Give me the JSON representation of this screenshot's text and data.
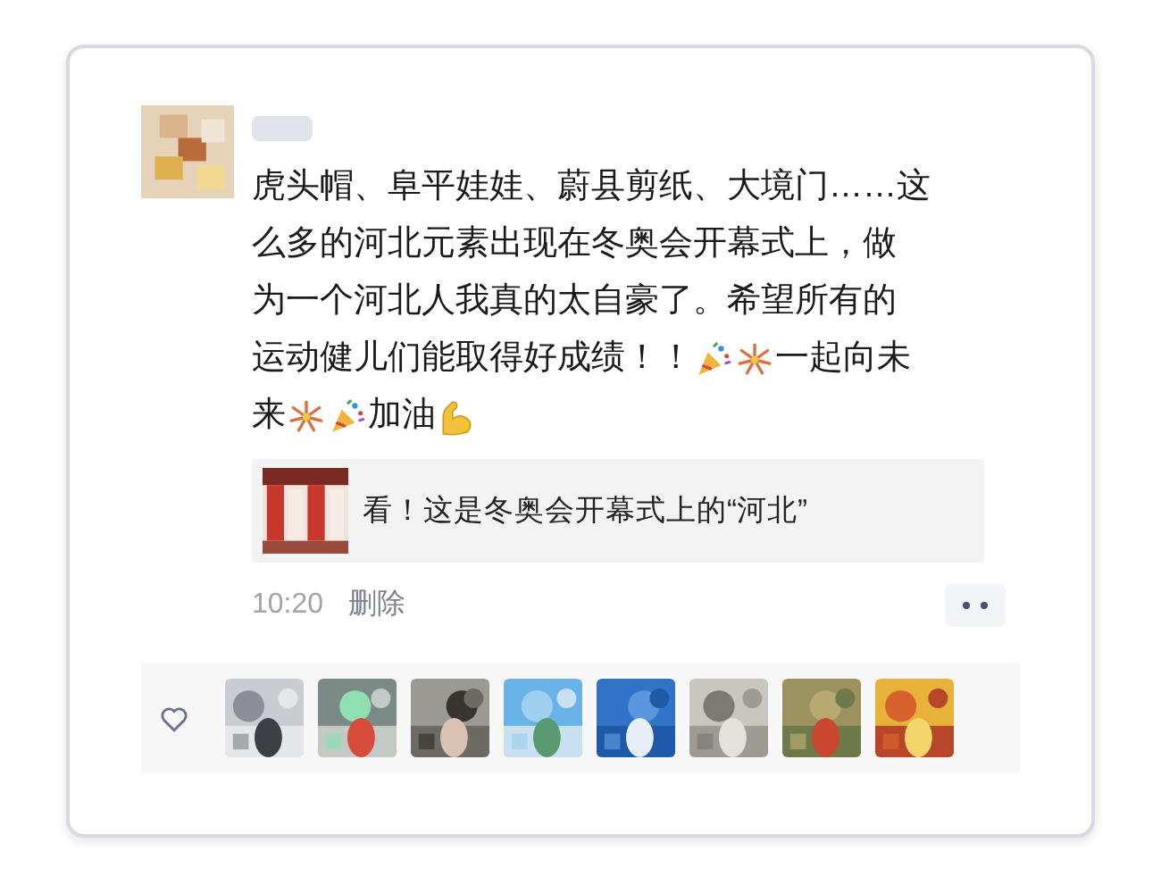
{
  "post": {
    "avatar": {
      "kind": "picture"
    },
    "lines": [
      [
        {
          "kind": "text",
          "text": "虎头帽、阜平娃娃、蔚县剪纸、大境门……这"
        }
      ],
      [
        {
          "kind": "text",
          "text": "么多的河北元素出现在冬奥会开幕式上，做"
        }
      ],
      [
        {
          "kind": "text",
          "text": "为一个河北人我真的太自豪了。希望所有的"
        }
      ],
      [
        {
          "kind": "text",
          "text": "运动健儿们能取得好成绩！！"
        },
        {
          "kind": "popper"
        },
        {
          "kind": "fireworks"
        },
        {
          "kind": "text",
          "text": "一起向未"
        }
      ],
      [
        {
          "kind": "text",
          "text": "来"
        },
        {
          "kind": "fireworks"
        },
        {
          "kind": "popper"
        },
        {
          "kind": "text",
          "text": "加油"
        },
        {
          "kind": "muscle"
        }
      ]
    ],
    "link": {
      "thumbnail": {
        "kind": "picture"
      },
      "title": "看！这是冬奥会开幕式上的“河北”"
    },
    "time": "10:20",
    "delete": "删除"
  },
  "likes": [
    {
      "kind": "picture"
    },
    {
      "kind": "picture"
    },
    {
      "kind": "picture"
    },
    {
      "kind": "picture"
    },
    {
      "kind": "picture"
    },
    {
      "kind": "picture"
    },
    {
      "kind": "picture"
    },
    {
      "kind": "picture"
    }
  ]
}
